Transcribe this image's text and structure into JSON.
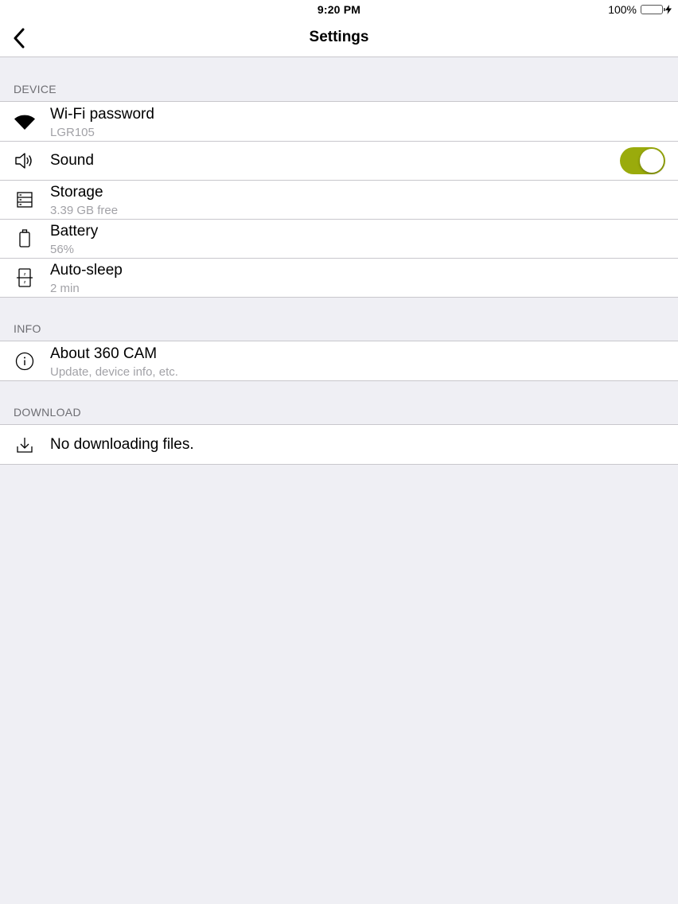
{
  "status_bar": {
    "time": "9:20 PM",
    "battery_percent": "100%",
    "battery_icon": "battery-full-icon",
    "charging_icon": "bolt-icon"
  },
  "nav": {
    "title": "Settings",
    "back_icon": "chevron-left-icon"
  },
  "sections": {
    "device": {
      "header": "DEVICE",
      "items": [
        {
          "icon": "wifi-icon",
          "label": "Wi-Fi password",
          "sub": "LGR105"
        },
        {
          "icon": "speaker-icon",
          "label": "Sound",
          "toggle_on": true
        },
        {
          "icon": "storage-icon",
          "label": "Storage",
          "sub": "3.39 GB free"
        },
        {
          "icon": "battery-icon",
          "label": "Battery",
          "sub": "56%"
        },
        {
          "icon": "auto-sleep-icon",
          "label": "Auto-sleep",
          "sub": "2 min"
        }
      ]
    },
    "info": {
      "header": "INFO",
      "items": [
        {
          "icon": "info-icon",
          "label": "About 360 CAM",
          "sub": "Update, device info, etc."
        }
      ]
    },
    "download": {
      "header": "DOWNLOAD",
      "items": [
        {
          "icon": "download-icon",
          "label": "No downloading files."
        }
      ]
    }
  },
  "colors": {
    "background": "#efeff4",
    "toggle_on": "#9aab0c",
    "secondary_text": "#a2a2a7",
    "battery_fill": "#4cd964"
  }
}
